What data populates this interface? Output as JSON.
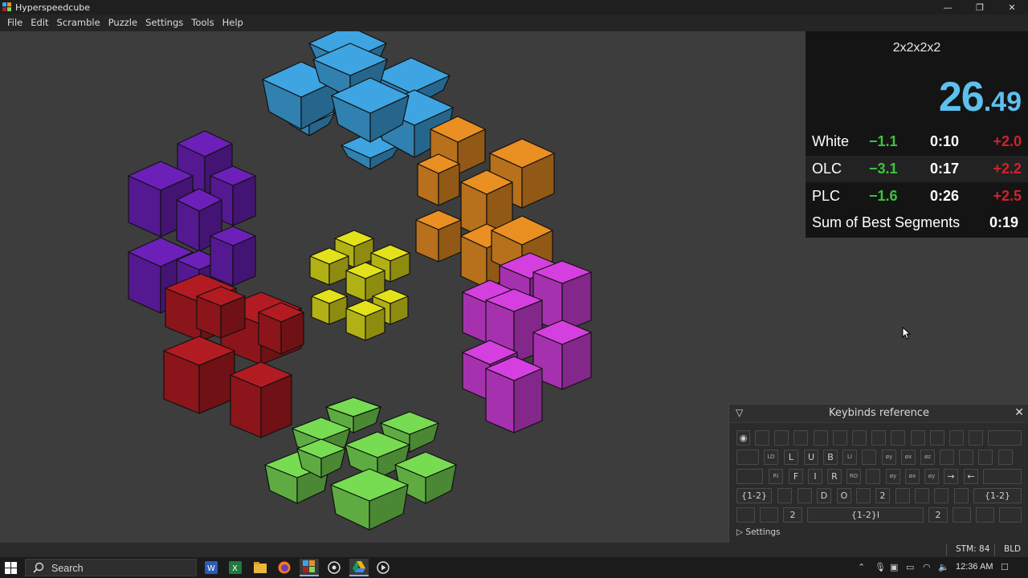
{
  "window": {
    "title": "Hyperspeedcube"
  },
  "menu": [
    "File",
    "Edit",
    "Scramble",
    "Puzzle",
    "Settings",
    "Tools",
    "Help"
  ],
  "timer": {
    "puzzle_name": "2x2x2x2",
    "time_main": "26",
    "time_dec": ".49",
    "color": "#5cc1ee",
    "splits": [
      {
        "name": "White",
        "delta": "−1.1",
        "time": "0:10",
        "gain": "+2.0"
      },
      {
        "name": "OLC",
        "delta": "−3.1",
        "time": "0:17",
        "gain": "+2.2"
      },
      {
        "name": "PLC",
        "delta": "−1.6",
        "time": "0:26",
        "gain": "+2.5"
      }
    ],
    "sob_label": "Sum of Best Segments",
    "sob_value": "0:19"
  },
  "puzzle_colors": {
    "blue": "#3ea4e2",
    "orange": "#ea8f22",
    "purple": "#6c20b9",
    "yellow": "#e3e11a",
    "red": "#b31b22",
    "magenta": "#d53fdf",
    "green": "#78dc53"
  },
  "keybinds": {
    "title": "Keybinds reference",
    "settings_label": "Settings",
    "rows": [
      [
        "",
        "",
        "",
        "",
        "",
        "",
        "",
        "",
        "",
        "",
        "",
        "",
        "",
        ""
      ],
      [
        "LO",
        "L",
        "U",
        "B",
        "LI",
        "",
        "øy",
        "øx",
        "øz"
      ],
      [
        "RI",
        "F",
        "I",
        "R",
        "RO",
        "",
        "øy",
        "øx",
        "øy"
      ],
      [
        "{1-2}",
        "D",
        "O",
        "2",
        "{1-2}"
      ],
      [
        "2",
        "{1-2}I",
        "2"
      ]
    ]
  },
  "status": {
    "stm": "STM: 84",
    "mode": "BLD"
  },
  "taskbar": {
    "search_label": "Search",
    "apps": [
      "word-icon",
      "excel-icon",
      "file-explorer-icon",
      "firefox-icon",
      "hyperspeedcube-icon",
      "obs-icon",
      "drive-icon",
      "media-icon"
    ],
    "clock": "12:36 AM"
  }
}
